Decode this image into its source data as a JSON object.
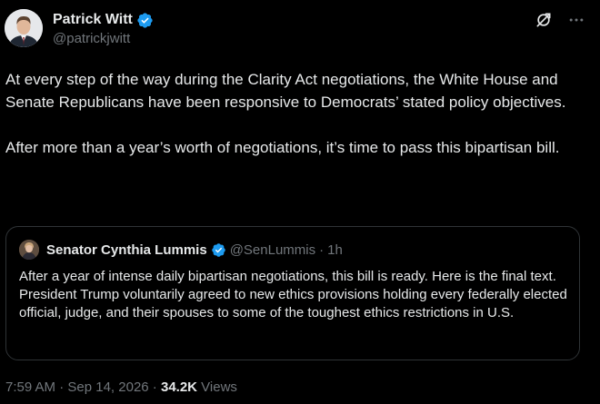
{
  "author": {
    "display_name": "Patrick Witt",
    "handle": "@patrickjwitt"
  },
  "post": {
    "paragraphs": [
      "At every step of the way during the Clarity Act negotiations, the White House and Senate Republicans have been responsive to Democrats’ stated policy objectives.",
      "After more than a year’s worth of negotiations, it’s time to pass this bipartisan bill."
    ]
  },
  "quote": {
    "display_name": "Senator Cynthia Lummis",
    "handle": "@SenLummis",
    "separator": "·",
    "time": "1h",
    "text": "After a year of intense daily bipartisan negotiations, this bill is ready. Here is the final text. President Trump voluntarily agreed to new ethics provisions holding every federally elected official, judge, and their spouses to some of the toughest ethics restrictions in U.S."
  },
  "meta": {
    "time": "7:59 AM",
    "dot1": " · ",
    "date": "Sep 14, 2026",
    "dot2": " · ",
    "views_count": "34.2K",
    "views_label": " Views"
  },
  "icons": {
    "verified": "verified-badge-icon",
    "grok": "grok-icon",
    "more": "more-options-icon"
  },
  "colors": {
    "background": "#000000",
    "text": "#e7e9ea",
    "secondary": "#71767b",
    "border": "#2f3336",
    "verified": "#1d9bf0"
  }
}
